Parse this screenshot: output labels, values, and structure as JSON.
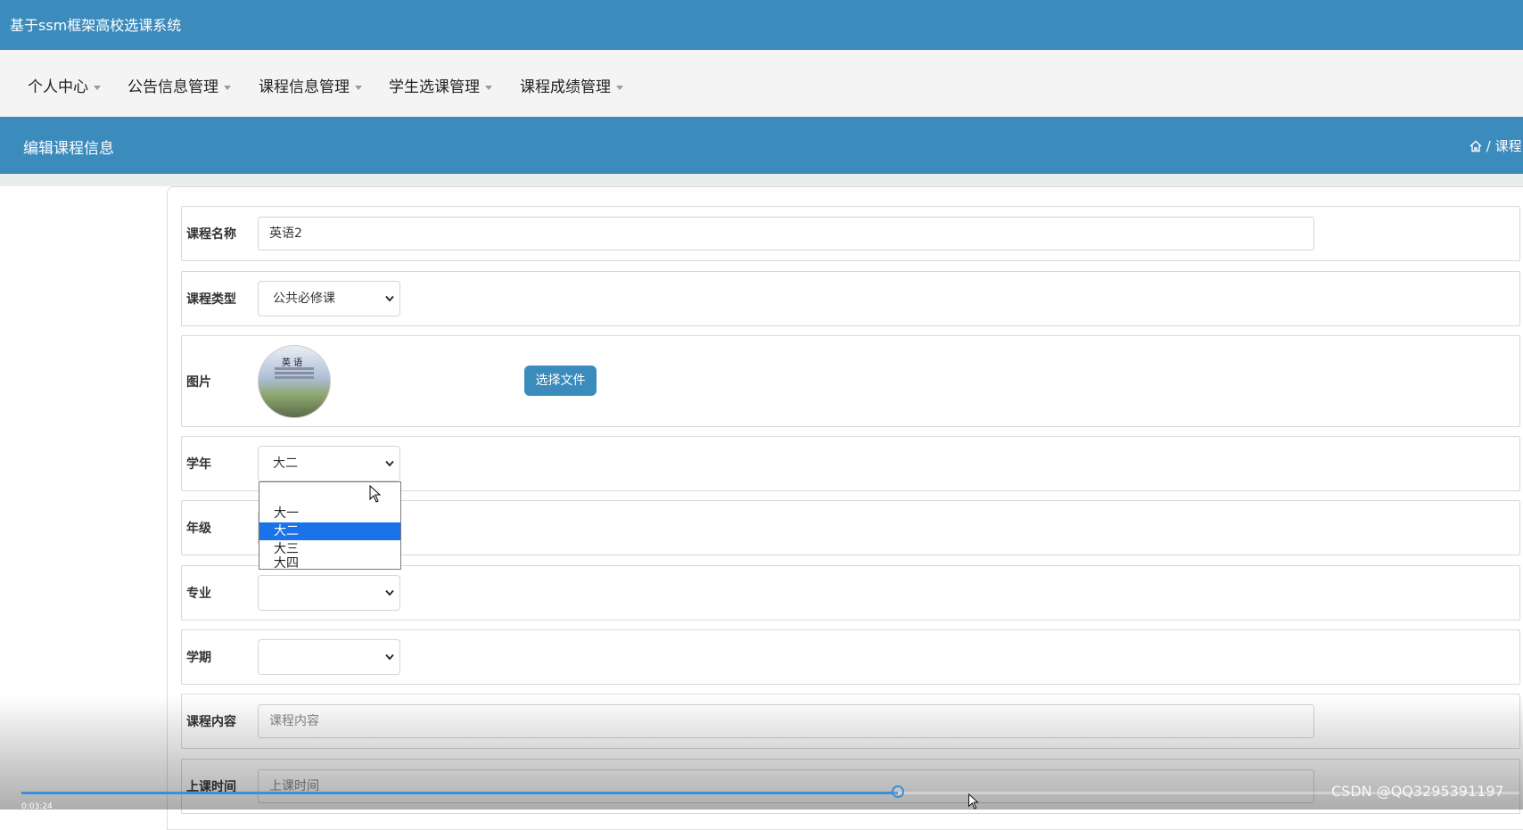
{
  "app": {
    "title": "基于ssm框架高校选课系统"
  },
  "nav": [
    {
      "label": "个人中心"
    },
    {
      "label": "公告信息管理"
    },
    {
      "label": "课程信息管理"
    },
    {
      "label": "学生选课管理"
    },
    {
      "label": "课程成绩管理"
    }
  ],
  "page": {
    "title": "编辑课程信息",
    "breadcrumb": "/ 课程"
  },
  "form": {
    "course_name": {
      "label": "课程名称",
      "value": "英语2"
    },
    "course_type": {
      "label": "课程类型",
      "value": "公共必修课"
    },
    "image": {
      "label": "图片",
      "cover_text": "英 语",
      "button": "选择文件"
    },
    "academic_year": {
      "label": "学年",
      "value": "大二",
      "options": [
        "大一",
        "大二",
        "大三",
        "大四"
      ],
      "highlighted": "大二"
    },
    "grade": {
      "label": "年级",
      "value": ""
    },
    "major": {
      "label": "专业",
      "value": ""
    },
    "semester": {
      "label": "学期",
      "value": ""
    },
    "content": {
      "label": "课程内容",
      "placeholder": "课程内容"
    },
    "class_time": {
      "label": "上课时间",
      "placeholder": "上课时间"
    }
  },
  "video": {
    "timecode": "0:03:24",
    "progress": 0.585
  },
  "watermark": "CSDN @QQ3295391197",
  "colors": {
    "primary": "#3c8bbd",
    "nav_bg": "#f4f4f4",
    "selected_option": "#1a73e8"
  }
}
